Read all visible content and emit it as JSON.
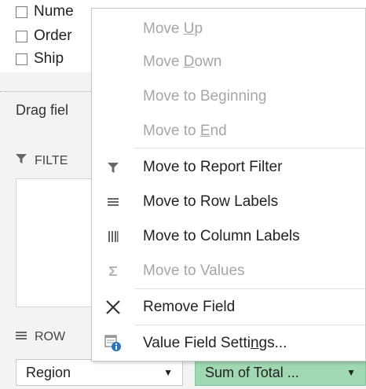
{
  "field_list": {
    "fields": [
      {
        "label": "Nume",
        "checked": false
      },
      {
        "label": "Order",
        "checked": false
      },
      {
        "label": "Ship",
        "checked": false
      }
    ],
    "drag_label": "Drag fiel",
    "filters_title": "FILTE",
    "rows_title": "ROW",
    "row_field": "Region",
    "value_field": "Sum of Total ..."
  },
  "context_menu": {
    "items": [
      {
        "pre": "Move ",
        "key": "U",
        "post": "p",
        "enabled": false,
        "icon": "none"
      },
      {
        "pre": "Move ",
        "key": "D",
        "post": "own",
        "enabled": false,
        "icon": "none"
      },
      {
        "pre": "Move to Be",
        "key": "g",
        "post": "inning",
        "enabled": false,
        "icon": "none"
      },
      {
        "pre": "Move to ",
        "key": "E",
        "post": "nd",
        "enabled": false,
        "icon": "none"
      },
      {
        "pre": "Move to Report Filter",
        "key": "",
        "post": "",
        "enabled": true,
        "icon": "filter-icon"
      },
      {
        "pre": "Move to Row Labels",
        "key": "",
        "post": "",
        "enabled": true,
        "icon": "row-labels-icon"
      },
      {
        "pre": "Move to Column Labels",
        "key": "",
        "post": "",
        "enabled": true,
        "icon": "column-labels-icon"
      },
      {
        "pre": "Move to Values",
        "key": "",
        "post": "",
        "enabled": false,
        "icon": "sigma-icon"
      },
      {
        "pre": "Remove Field",
        "key": "",
        "post": "",
        "enabled": true,
        "icon": "remove-x-icon"
      },
      {
        "pre": "Value Field Setti",
        "key": "n",
        "post": "gs...",
        "enabled": true,
        "icon": "field-settings-icon"
      }
    ]
  },
  "colors": {
    "value_field_bg": "#9fd8b3",
    "disabled_text": "#a6a6a6",
    "icon_gray": "#666666"
  }
}
